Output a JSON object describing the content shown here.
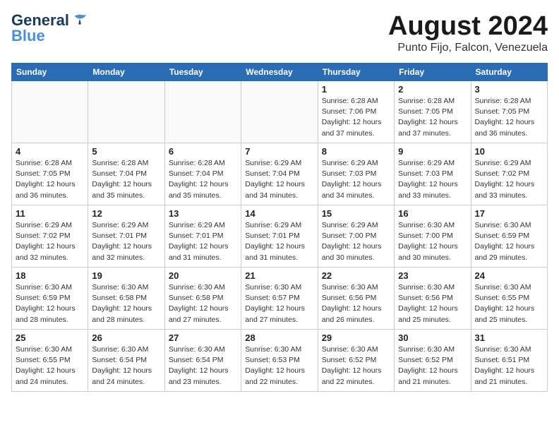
{
  "header": {
    "logo_general": "General",
    "logo_blue": "Blue",
    "title": "August 2024",
    "location": "Punto Fijo, Falcon, Venezuela"
  },
  "days_of_week": [
    "Sunday",
    "Monday",
    "Tuesday",
    "Wednesday",
    "Thursday",
    "Friday",
    "Saturday"
  ],
  "weeks": [
    [
      {
        "day": "",
        "info": ""
      },
      {
        "day": "",
        "info": ""
      },
      {
        "day": "",
        "info": ""
      },
      {
        "day": "",
        "info": ""
      },
      {
        "day": "1",
        "info": "Sunrise: 6:28 AM\nSunset: 7:06 PM\nDaylight: 12 hours\nand 37 minutes."
      },
      {
        "day": "2",
        "info": "Sunrise: 6:28 AM\nSunset: 7:05 PM\nDaylight: 12 hours\nand 37 minutes."
      },
      {
        "day": "3",
        "info": "Sunrise: 6:28 AM\nSunset: 7:05 PM\nDaylight: 12 hours\nand 36 minutes."
      }
    ],
    [
      {
        "day": "4",
        "info": "Sunrise: 6:28 AM\nSunset: 7:05 PM\nDaylight: 12 hours\nand 36 minutes."
      },
      {
        "day": "5",
        "info": "Sunrise: 6:28 AM\nSunset: 7:04 PM\nDaylight: 12 hours\nand 35 minutes."
      },
      {
        "day": "6",
        "info": "Sunrise: 6:28 AM\nSunset: 7:04 PM\nDaylight: 12 hours\nand 35 minutes."
      },
      {
        "day": "7",
        "info": "Sunrise: 6:29 AM\nSunset: 7:04 PM\nDaylight: 12 hours\nand 34 minutes."
      },
      {
        "day": "8",
        "info": "Sunrise: 6:29 AM\nSunset: 7:03 PM\nDaylight: 12 hours\nand 34 minutes."
      },
      {
        "day": "9",
        "info": "Sunrise: 6:29 AM\nSunset: 7:03 PM\nDaylight: 12 hours\nand 33 minutes."
      },
      {
        "day": "10",
        "info": "Sunrise: 6:29 AM\nSunset: 7:02 PM\nDaylight: 12 hours\nand 33 minutes."
      }
    ],
    [
      {
        "day": "11",
        "info": "Sunrise: 6:29 AM\nSunset: 7:02 PM\nDaylight: 12 hours\nand 32 minutes."
      },
      {
        "day": "12",
        "info": "Sunrise: 6:29 AM\nSunset: 7:01 PM\nDaylight: 12 hours\nand 32 minutes."
      },
      {
        "day": "13",
        "info": "Sunrise: 6:29 AM\nSunset: 7:01 PM\nDaylight: 12 hours\nand 31 minutes."
      },
      {
        "day": "14",
        "info": "Sunrise: 6:29 AM\nSunset: 7:01 PM\nDaylight: 12 hours\nand 31 minutes."
      },
      {
        "day": "15",
        "info": "Sunrise: 6:29 AM\nSunset: 7:00 PM\nDaylight: 12 hours\nand 30 minutes."
      },
      {
        "day": "16",
        "info": "Sunrise: 6:30 AM\nSunset: 7:00 PM\nDaylight: 12 hours\nand 30 minutes."
      },
      {
        "day": "17",
        "info": "Sunrise: 6:30 AM\nSunset: 6:59 PM\nDaylight: 12 hours\nand 29 minutes."
      }
    ],
    [
      {
        "day": "18",
        "info": "Sunrise: 6:30 AM\nSunset: 6:59 PM\nDaylight: 12 hours\nand 28 minutes."
      },
      {
        "day": "19",
        "info": "Sunrise: 6:30 AM\nSunset: 6:58 PM\nDaylight: 12 hours\nand 28 minutes."
      },
      {
        "day": "20",
        "info": "Sunrise: 6:30 AM\nSunset: 6:58 PM\nDaylight: 12 hours\nand 27 minutes."
      },
      {
        "day": "21",
        "info": "Sunrise: 6:30 AM\nSunset: 6:57 PM\nDaylight: 12 hours\nand 27 minutes."
      },
      {
        "day": "22",
        "info": "Sunrise: 6:30 AM\nSunset: 6:56 PM\nDaylight: 12 hours\nand 26 minutes."
      },
      {
        "day": "23",
        "info": "Sunrise: 6:30 AM\nSunset: 6:56 PM\nDaylight: 12 hours\nand 25 minutes."
      },
      {
        "day": "24",
        "info": "Sunrise: 6:30 AM\nSunset: 6:55 PM\nDaylight: 12 hours\nand 25 minutes."
      }
    ],
    [
      {
        "day": "25",
        "info": "Sunrise: 6:30 AM\nSunset: 6:55 PM\nDaylight: 12 hours\nand 24 minutes."
      },
      {
        "day": "26",
        "info": "Sunrise: 6:30 AM\nSunset: 6:54 PM\nDaylight: 12 hours\nand 24 minutes."
      },
      {
        "day": "27",
        "info": "Sunrise: 6:30 AM\nSunset: 6:54 PM\nDaylight: 12 hours\nand 23 minutes."
      },
      {
        "day": "28",
        "info": "Sunrise: 6:30 AM\nSunset: 6:53 PM\nDaylight: 12 hours\nand 22 minutes."
      },
      {
        "day": "29",
        "info": "Sunrise: 6:30 AM\nSunset: 6:52 PM\nDaylight: 12 hours\nand 22 minutes."
      },
      {
        "day": "30",
        "info": "Sunrise: 6:30 AM\nSunset: 6:52 PM\nDaylight: 12 hours\nand 21 minutes."
      },
      {
        "day": "31",
        "info": "Sunrise: 6:30 AM\nSunset: 6:51 PM\nDaylight: 12 hours\nand 21 minutes."
      }
    ]
  ]
}
